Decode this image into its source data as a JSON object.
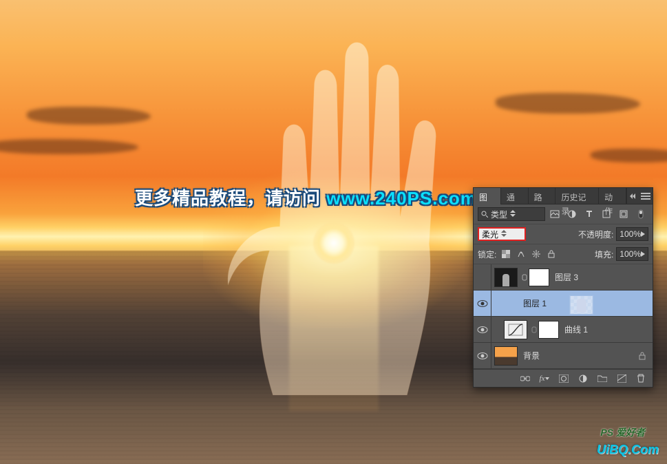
{
  "watermark": {
    "text_a": "更多精品教程，请访问 ",
    "link": "www.240PS.com",
    "corner_site": "UiBQ.Com",
    "corner_script": "PS 爱好者"
  },
  "panel": {
    "tabs": [
      "图层",
      "通道",
      "路径",
      "历史记录",
      "动作"
    ],
    "active_tab": 0,
    "filter": {
      "label": "类型",
      "placeholder": "类型",
      "icons": [
        "image-icon",
        "adjust-icon",
        "text-icon",
        "shape-icon",
        "smart-icon"
      ]
    },
    "blend": {
      "mode": "柔光",
      "opacity_label": "不透明度:",
      "opacity_value": "100%"
    },
    "lock": {
      "label": "锁定:",
      "fill_label": "填充:",
      "fill_value": "100%"
    },
    "layers": [
      {
        "visible": false,
        "name": "图层 3",
        "kind": "dark-hand",
        "has_mask": true,
        "selected": false,
        "locked": false,
        "indent": 0
      },
      {
        "visible": true,
        "name": "图层 1",
        "kind": "hand",
        "has_mask": false,
        "selected": true,
        "locked": false,
        "indent": 0
      },
      {
        "visible": true,
        "name": "曲线 1",
        "kind": "curves",
        "has_mask": true,
        "selected": false,
        "locked": false,
        "indent": 1
      },
      {
        "visible": true,
        "name": "背景",
        "kind": "background",
        "has_mask": false,
        "selected": false,
        "locked": true,
        "indent": 0
      }
    ],
    "bottom_icons": [
      "link-icon",
      "fx-icon",
      "mask-icon",
      "adjustment-icon",
      "group-icon",
      "new-layer-icon",
      "trash-icon"
    ]
  }
}
